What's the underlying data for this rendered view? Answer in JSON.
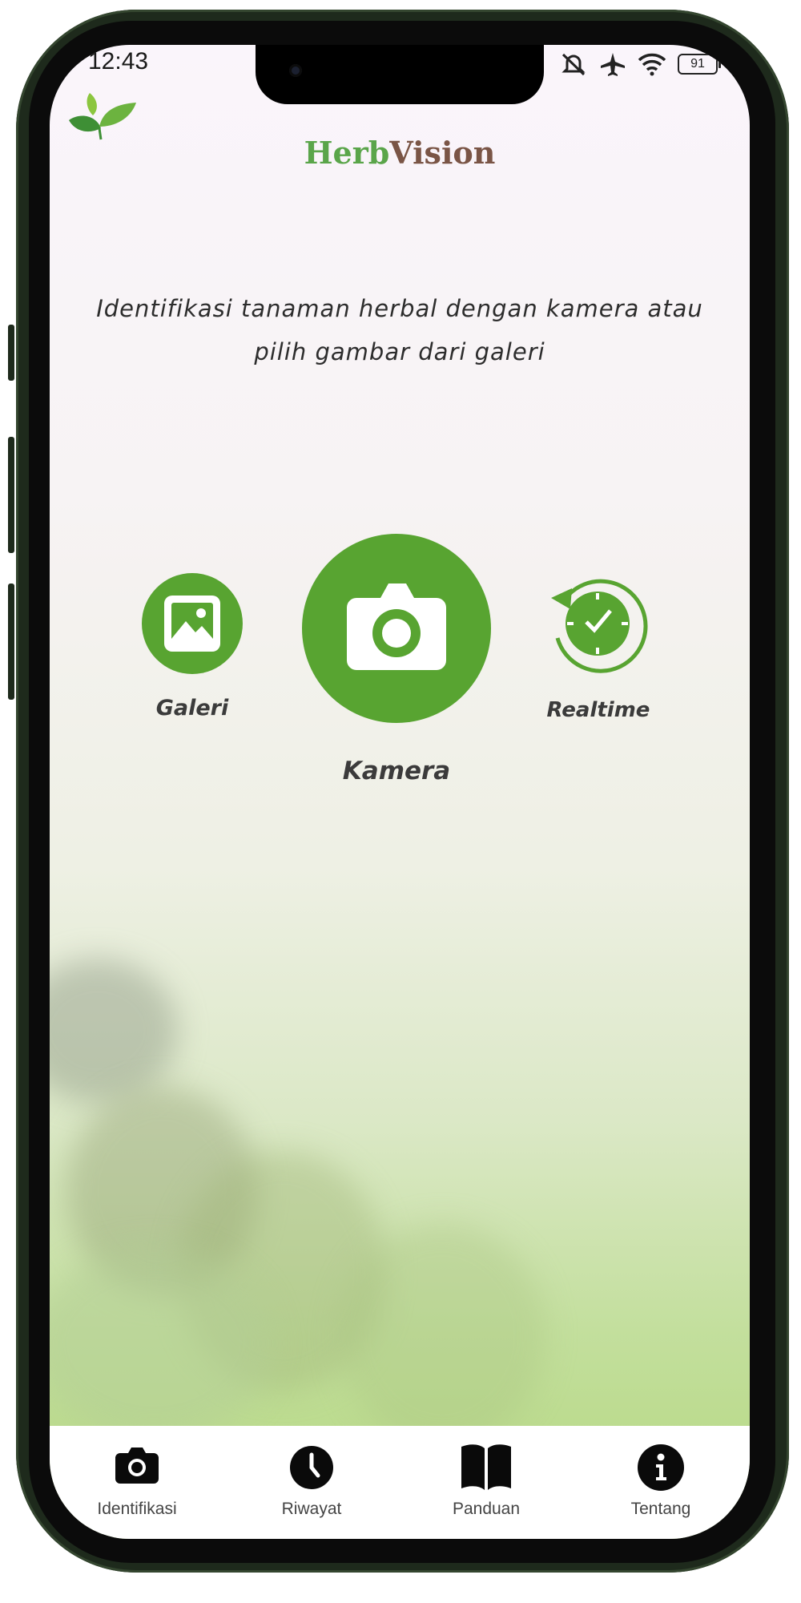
{
  "status_bar": {
    "time": "12:43",
    "battery": "91"
  },
  "app": {
    "brand_part1": "Herb",
    "brand_part2": "Vision"
  },
  "main": {
    "instruction": "Identifikasi tanaman herbal dengan kamera atau pilih gambar dari galeri",
    "actions": {
      "gallery_label": "Galeri",
      "camera_label": "Kamera",
      "realtime_label": "Realtime"
    }
  },
  "bottom_nav": {
    "items": [
      {
        "label": "Identifikasi",
        "icon": "camera-icon"
      },
      {
        "label": "Riwayat",
        "icon": "clock-icon"
      },
      {
        "label": "Panduan",
        "icon": "book-icon"
      },
      {
        "label": "Tentang",
        "icon": "info-icon"
      }
    ]
  },
  "colors": {
    "accent": "#58a431",
    "brand_green": "#5aa54a",
    "brand_brown": "#7a5546"
  }
}
